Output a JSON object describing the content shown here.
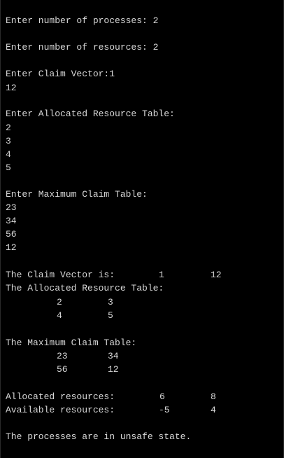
{
  "console": {
    "prompt_processes": "Enter number of processes: 2",
    "prompt_resources": "Enter number of resources: 2",
    "prompt_claim_vector": "Enter Claim Vector:1",
    "claim_vector_input": "12",
    "prompt_allocated": "Enter Allocated Resource Table:",
    "allocated_inputs": [
      "2",
      "3",
      "4",
      "5"
    ],
    "prompt_max_claim": "Enter Maximum Claim Table:",
    "max_claim_inputs": [
      "23",
      "34",
      "56",
      "12"
    ],
    "claim_vector_label": "The Claim Vector is:",
    "claim_vector_values": [
      "1",
      "12"
    ],
    "allocated_table_title": "The Allocated Resource Table:",
    "allocated_table": [
      [
        "2",
        "3"
      ],
      [
        "4",
        "5"
      ]
    ],
    "max_claim_table_title": "The Maximum Claim Table:",
    "max_claim_table": [
      [
        "23",
        "34"
      ],
      [
        "56",
        "12"
      ]
    ],
    "allocated_resources_label": "Allocated resources:",
    "allocated_resources": [
      "6",
      "8"
    ],
    "available_resources_label": "Available resources:",
    "available_resources": [
      "-5",
      "4"
    ],
    "result": "The processes are in unsafe state."
  }
}
